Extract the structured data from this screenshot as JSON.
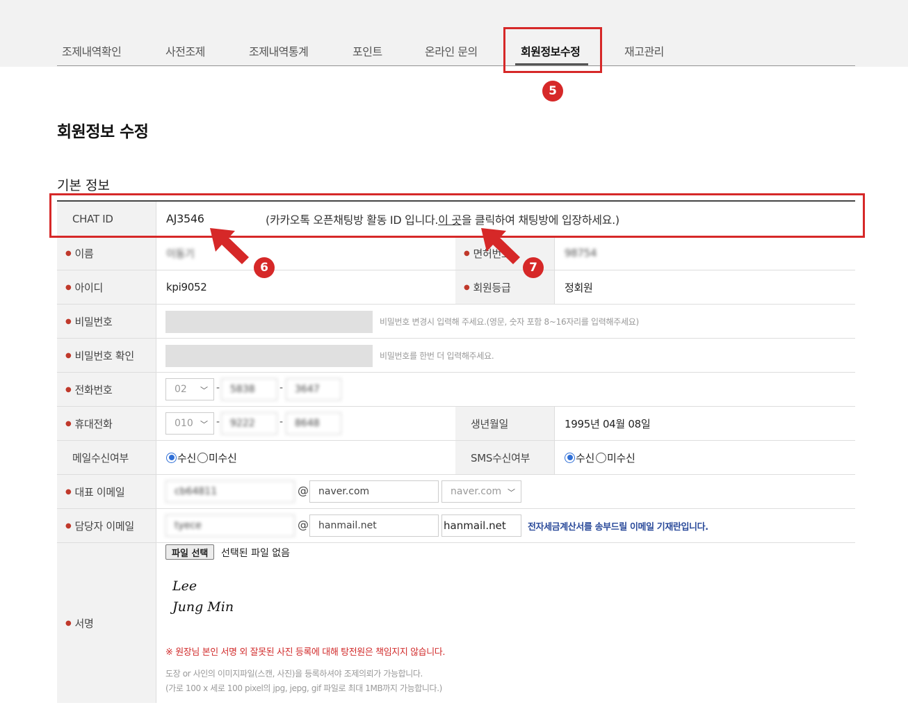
{
  "tabs": [
    {
      "label": "조제내역확인"
    },
    {
      "label": "사전조제"
    },
    {
      "label": "조제내역통계"
    },
    {
      "label": "포인트"
    },
    {
      "label": "온라인 문의"
    },
    {
      "label": "회원정보수정",
      "active": true
    },
    {
      "label": "재고관리"
    }
  ],
  "page_title": "회원정보 수정",
  "section_title": "기본 정보",
  "chat_id": {
    "label": "CHAT ID",
    "value": "AJ3546",
    "desc_prefix": "(카카오톡 오픈채팅방 활동 ID 입니다. ",
    "desc_link": "이 곳",
    "desc_suffix": "을 클릭하여 채팅방에 입장하세요.)"
  },
  "name": {
    "label": "이름",
    "value": "이동기"
  },
  "license": {
    "label": "면허번호",
    "value": "98754"
  },
  "user_id": {
    "label": "아이디",
    "value": "kpi9052"
  },
  "grade": {
    "label": "회원등급",
    "value": "정회원"
  },
  "password": {
    "label": "비밀번호",
    "hint": "비밀번호 변경시 입력해 주세요.(영문, 숫자 포함 8~16자리를 입력해주세요)"
  },
  "password_confirm": {
    "label": "비밀번호 확인",
    "hint": "비밀번호를 한번 더 입력해주세요."
  },
  "phone": {
    "label": "전화번호",
    "area": "02",
    "mid": "5838",
    "last": "3647"
  },
  "mobile": {
    "label": "휴대전화",
    "area": "010",
    "mid": "9222",
    "last": "8648"
  },
  "birth": {
    "label": "생년월일",
    "value": "1995년 04월 08일"
  },
  "mail_opt": {
    "label": "메일수신여부",
    "yes": "수신",
    "no": "미수신",
    "selected": "yes"
  },
  "sms_opt": {
    "label": "SMS수신여부",
    "yes": "수신",
    "no": "미수신",
    "selected": "yes"
  },
  "main_email": {
    "label": "대표 이메일",
    "local": "cb64811",
    "domain": "naver.com",
    "select": "naver.com"
  },
  "manager_email": {
    "label": "담당자 이메일",
    "local": "tyece",
    "domain": "hanmail.net",
    "select": "hanmail.net",
    "note": "전자세금계산서를 송부드릴 이메일 기재란입니다."
  },
  "signature": {
    "label": "서명",
    "file_button": "파일 선택",
    "file_status": "선택된 파일 없음",
    "sig_line1": "Lee",
    "sig_line2": "Jung Min",
    "warning": "※ 원장님 본인 서명 외 잘못된 사진 등록에 대해 탕전원은 책임지지 않습니다.",
    "note1": "도장 or 사인의 이미지파일(스캔, 사진)을 등록하셔야 조제의뢰가 가능합니다.",
    "note2": "(가로 100 x 세로 100 pixel의 jpg, jepg, gif 파일로 최대 1MB까지 가능합니다.)"
  },
  "annotations": {
    "badge5": "5",
    "badge6": "6",
    "badge7": "7",
    "color": "#d62828"
  }
}
